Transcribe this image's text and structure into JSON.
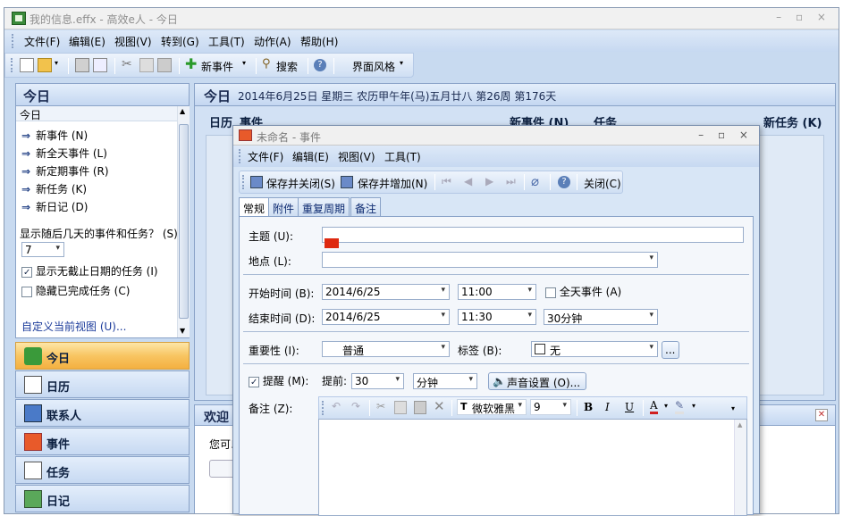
{
  "window": {
    "title": "我的信息.effx - 高效e人 - 今日",
    "controls": "– ▫ ×"
  },
  "menu": [
    "文件(F)",
    "编辑(E)",
    "视图(V)",
    "转到(G)",
    "工具(T)",
    "动作(A)",
    "帮助(H)"
  ],
  "toolbar": {
    "new_event": "新事件",
    "search": "搜索",
    "theme": "界面风格"
  },
  "left": {
    "header": "今日",
    "section": "今日",
    "actions": [
      "新事件 (N)",
      "新全天事件 (L)",
      "新定期事件 (R)",
      "新任务 (K)",
      "新日记 (D)"
    ],
    "days_label": "显示随后几天的事件和任务？ (S)",
    "days_value": "7",
    "show_nodue": "显示无截止日期的任务 (I)",
    "hide_done": "隐藏已完成任务 (C)",
    "customize": "自定义当前视图 (U)..."
  },
  "nav": [
    "今日",
    "日历",
    "联系人",
    "事件",
    "任务",
    "日记"
  ],
  "today": {
    "title": "今日",
    "date": "2014年6月25日 星期三 农历甲午年(马)五月廿八 第26周 第176天",
    "cal_col": "日历",
    "event_col": "事件",
    "new_event": "新事件 (N)",
    "task_col": "任务",
    "new_task": "新任务 (K)"
  },
  "welcome": {
    "title": "欢迎",
    "text": "您可以"
  },
  "dialog": {
    "title": "未命名 - 事件",
    "controls": "– ▫ ×",
    "menu": [
      "文件(F)",
      "编辑(E)",
      "视图(V)",
      "工具(T)"
    ],
    "save_close": "保存并关闭(S)",
    "save_add": "保存并增加(N)",
    "close": "关闭(C)",
    "tabs": [
      "常规",
      "附件",
      "重复周期",
      "备注"
    ],
    "subject_label": "主题 (U):",
    "subject_value": "",
    "location_label": "地点 (L):",
    "location_value": "",
    "start_label": "开始时间 (B):",
    "start_date": "2014/6/25",
    "start_time": "11:00",
    "allday": "全天事件 (A)",
    "end_label": "结束时间 (D):",
    "end_date": "2014/6/25",
    "end_time": "11:30",
    "duration": "30分钟",
    "importance_label": "重要性 (I):",
    "importance": "普通",
    "tag_label": "标签 (B):",
    "tag": "无",
    "more": "...",
    "remind_label": "提醒 (M):",
    "ahead_label": "提前:",
    "ahead_value": "30",
    "unit": "分钟",
    "sound": "声音设置 (O)...",
    "note_label": "备注 (Z):",
    "font": "微软雅黑",
    "size": "9"
  }
}
